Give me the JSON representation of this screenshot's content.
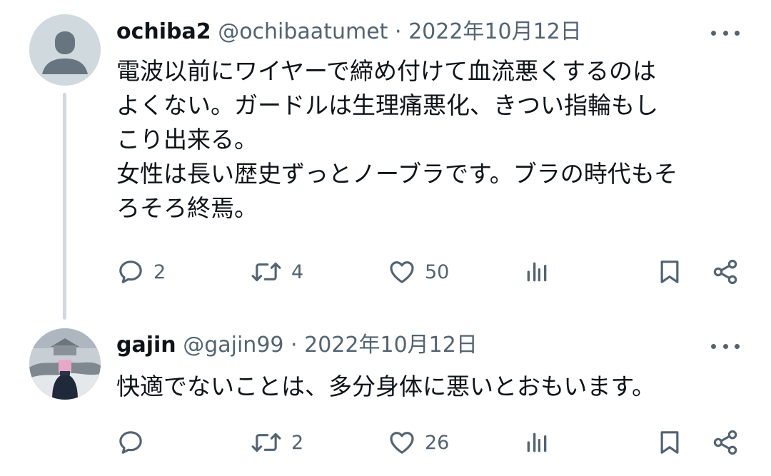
{
  "tweets": [
    {
      "display_name": "ochiba2",
      "handle": "@ochibaatumet",
      "separator": "·",
      "date": "2022年10月12日",
      "body_lines": [
        "電波以前にワイヤーで締め付けて血流悪くするのは",
        "よくない。ガードルは生理痛悪化、きつい指輪もし",
        "こり出来る。",
        "女性は長い歴史ずっとノーブラです。ブラの時代もそ",
        "ろそろ終焉。"
      ],
      "replies": "2",
      "retweets": "4",
      "likes": "50"
    },
    {
      "display_name": "gajin",
      "handle": "@gajin99",
      "separator": "·",
      "date": "2022年10月12日",
      "body_lines": [
        "快適でないことは、多分身体に悪いとおもいます。"
      ],
      "replies": "",
      "retweets": "2",
      "likes": "26"
    }
  ],
  "icons": {
    "more": "more-horizontal-icon",
    "reply": "reply-bubble-icon",
    "retweet": "retweet-icon",
    "like": "heart-icon",
    "views": "views-bar-chart-icon",
    "bookmark": "bookmark-icon",
    "share": "share-icon"
  },
  "colors": {
    "text": "#0f1419",
    "secondary": "#536471",
    "thread_line": "#cfd9de"
  }
}
